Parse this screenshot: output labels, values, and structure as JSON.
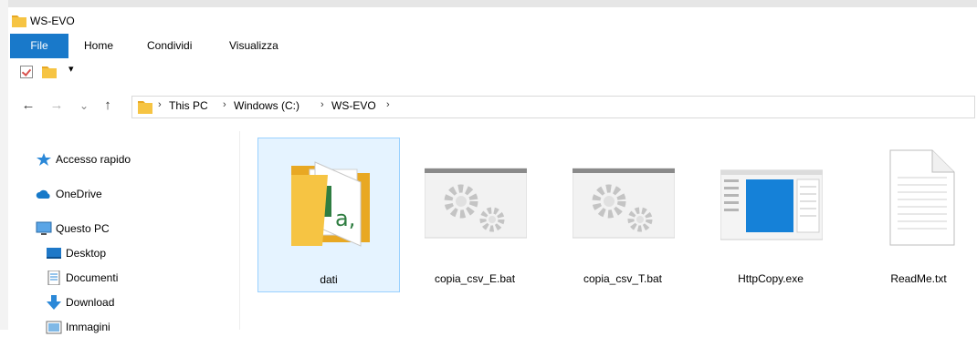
{
  "window": {
    "title": "WS-EVO"
  },
  "ribbon": {
    "tabs": [
      "File",
      "Home",
      "Condividi",
      "Visualizza"
    ]
  },
  "qat": {
    "dropdown_glyph": "▾"
  },
  "nav": {
    "back": "←",
    "forward": "→",
    "recent": "⌄",
    "up": "↑",
    "separator": "›",
    "breadcrumb": [
      "This PC",
      "Windows (C:)",
      "WS-EVO"
    ]
  },
  "sidebar": {
    "items": [
      {
        "label": "Accesso rapido",
        "icon": "star-icon"
      },
      {
        "label": "OneDrive",
        "icon": "cloud-icon"
      },
      {
        "label": "Questo PC",
        "icon": "computer-icon"
      },
      {
        "label": "Desktop",
        "icon": "desktop-icon"
      },
      {
        "label": "Documenti",
        "icon": "documents-icon"
      },
      {
        "label": "Download",
        "icon": "download-arrow-icon"
      },
      {
        "label": "Immagini",
        "icon": "pictures-icon"
      }
    ]
  },
  "files": [
    {
      "name": "dati",
      "type": "folder",
      "selected": true
    },
    {
      "name": "copia_csv_E.bat",
      "type": "bat"
    },
    {
      "name": "copia_csv_T.bat",
      "type": "bat"
    },
    {
      "name": "HttpCopy.exe",
      "type": "exe"
    },
    {
      "name": "ReadMe.txt",
      "type": "txt"
    }
  ],
  "colors": {
    "accent": "#1979ca",
    "selection": "#e5f3ff",
    "folder": "#f6c443"
  }
}
